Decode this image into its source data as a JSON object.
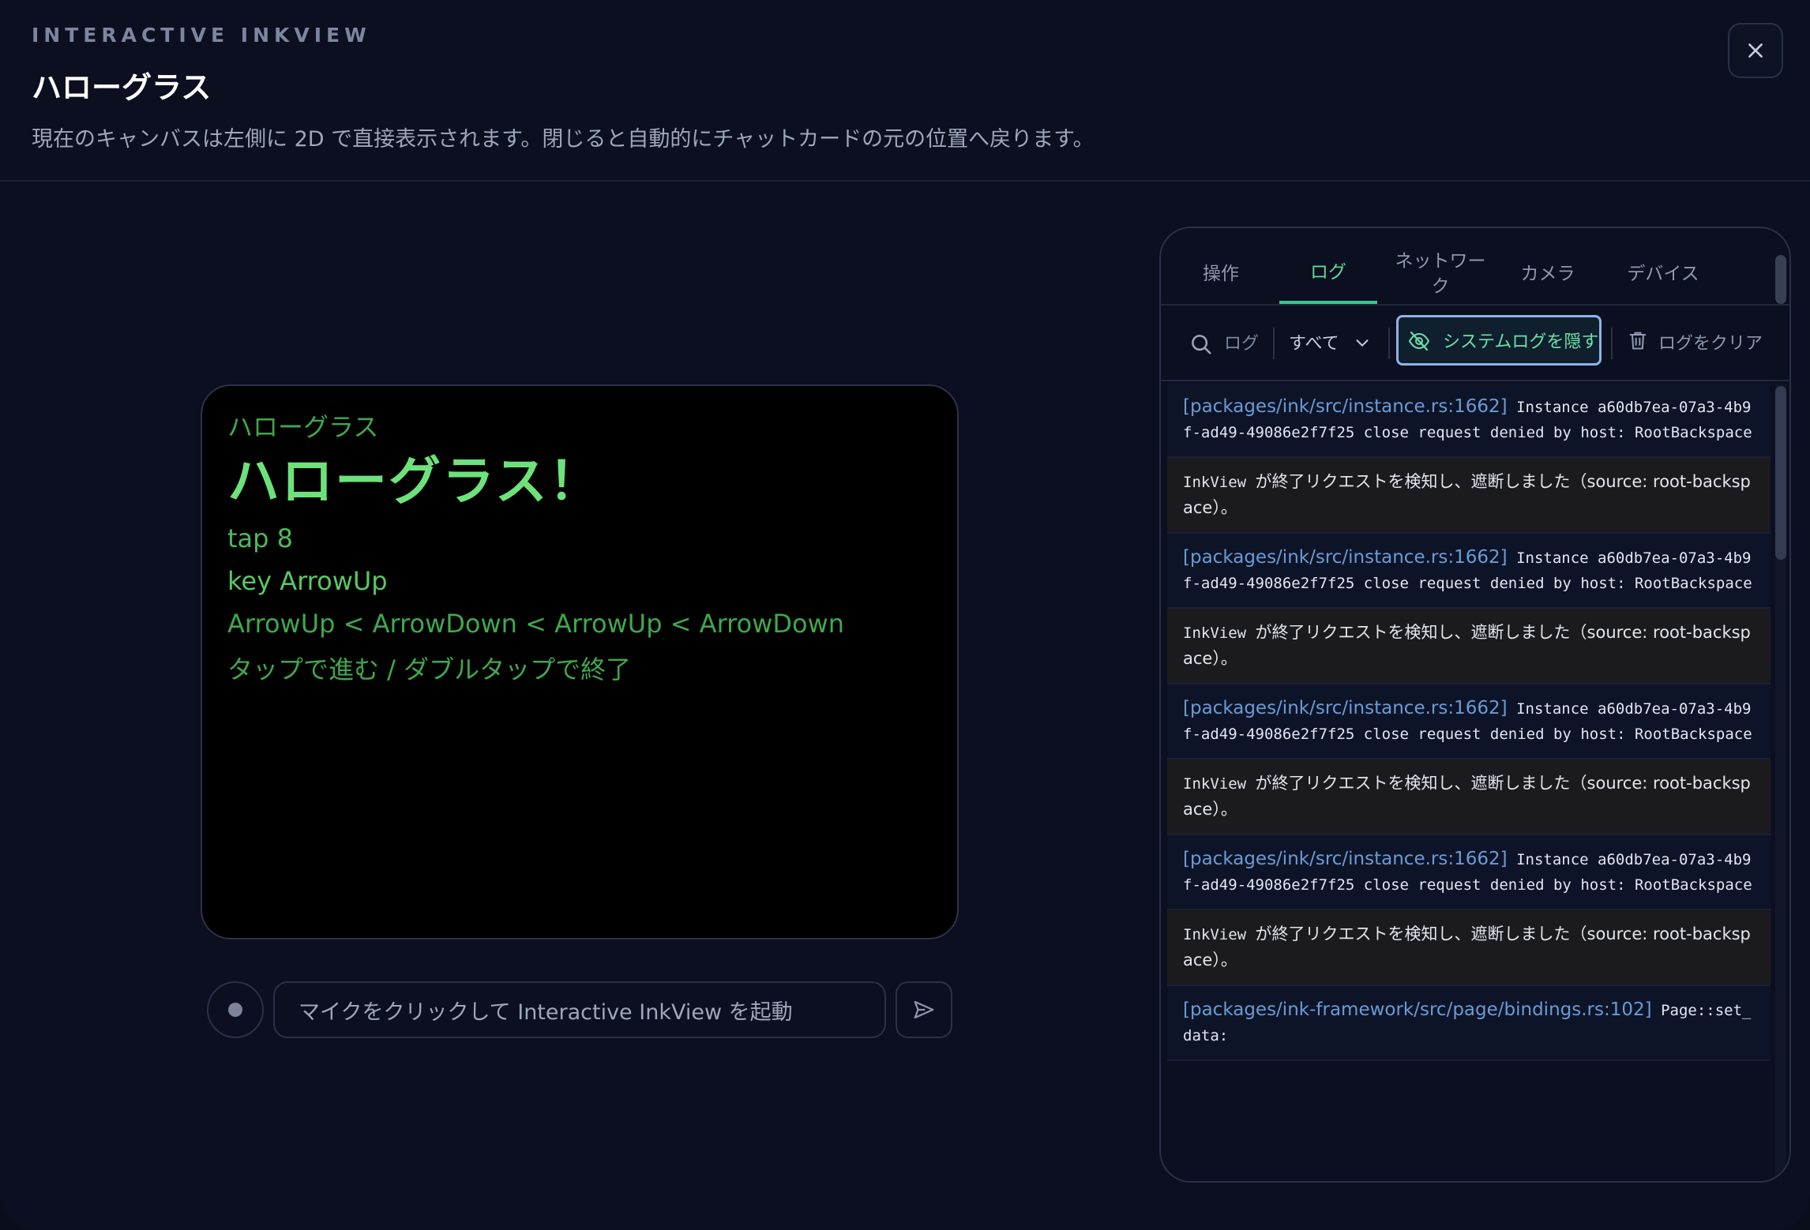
{
  "header": {
    "eyebrow": "INTERACTIVE INKVIEW",
    "title": "ハローグラス",
    "subtitle": "現在のキャンバスは左側に 2D で直接表示されます。閉じると自動的にチャットカードの元の位置へ戻ります。"
  },
  "close_icon": "close-icon",
  "canvas": {
    "small_title": "ハローグラス",
    "big_title": "ハローグラス！",
    "tap": "tap 8",
    "key": "key ArrowUp",
    "history": "ArrowUp < ArrowDown < ArrowUp < ArrowDown",
    "hint": "タップで進む / ダブルタップで終了"
  },
  "input": {
    "placeholder": "マイクをクリックして Interactive InkView を起動"
  },
  "panel": {
    "tabs": [
      {
        "label": "操作"
      },
      {
        "label": "ログ"
      },
      {
        "label": "ネットワーク"
      },
      {
        "label": "カメラ"
      },
      {
        "label": "デバイス"
      }
    ],
    "active_tab": "ログ",
    "toolbar": {
      "search_placeholder": "ログ",
      "filter_value": "すべて",
      "hide_system": "システムログを隠す",
      "clear": "ログをクリア"
    },
    "logs": [
      {
        "type": "system",
        "src": "[packages/ink/src/instance.rs:1662]",
        "msg": "Instance a60db7ea-07a3-4b9f-ad49-49086e2f7f25 close request denied by host: RootBackspace"
      },
      {
        "type": "warn",
        "prefix": "InkView",
        "msg": "が終了リクエストを検知し、遮断しました（source: root-backspace）。"
      },
      {
        "type": "system",
        "src": "[packages/ink/src/instance.rs:1662]",
        "msg": "Instance a60db7ea-07a3-4b9f-ad49-49086e2f7f25 close request denied by host: RootBackspace"
      },
      {
        "type": "warn",
        "prefix": "InkView",
        "msg": "が終了リクエストを検知し、遮断しました（source: root-backspace）。"
      },
      {
        "type": "system",
        "src": "[packages/ink/src/instance.rs:1662]",
        "msg": "Instance a60db7ea-07a3-4b9f-ad49-49086e2f7f25 close request denied by host: RootBackspace"
      },
      {
        "type": "warn",
        "prefix": "InkView",
        "msg": "が終了リクエストを検知し、遮断しました（source: root-backspace）。"
      },
      {
        "type": "system",
        "src": "[packages/ink/src/instance.rs:1662]",
        "msg": "Instance a60db7ea-07a3-4b9f-ad49-49086e2f7f25 close request denied by host: RootBackspace"
      },
      {
        "type": "warn",
        "prefix": "InkView",
        "msg": "が終了リクエストを検知し、遮断しました（source: root-backspace）。"
      },
      {
        "type": "system",
        "src": "[packages/ink-framework/src/page/bindings.rs:102]",
        "msg": "Page::set_data:"
      }
    ]
  },
  "colors": {
    "accent_green": "#37c88a",
    "canvas_green": "#6ee27a",
    "log_source_blue": "#6b9bd4",
    "background": "#0b0f1f"
  }
}
